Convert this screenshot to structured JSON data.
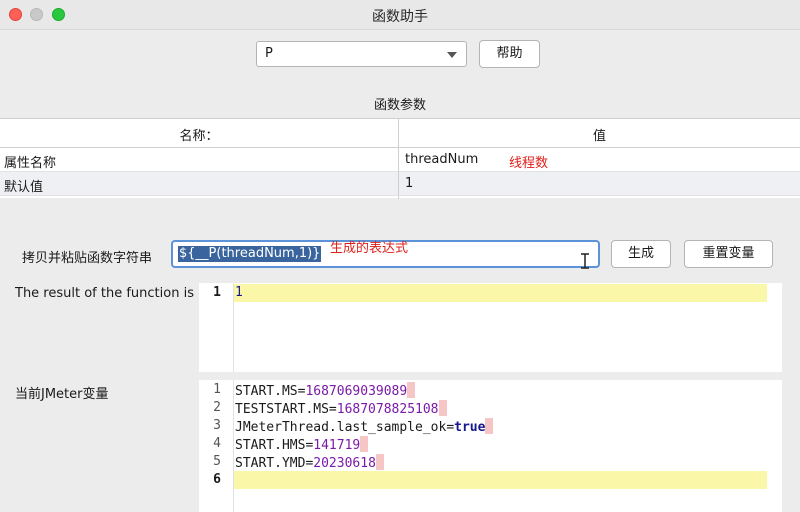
{
  "window": {
    "title": "函数助手"
  },
  "function_select": {
    "value": "P"
  },
  "help_button": {
    "label": "帮助"
  },
  "params_section": {
    "title": "函数参数"
  },
  "params_table": {
    "headers": [
      "名称：",
      "值"
    ],
    "rows": [
      {
        "name": "属性名称",
        "value": "threadNum"
      },
      {
        "name": "默认值",
        "value": "1"
      }
    ]
  },
  "annotations": {
    "thread_num": "线程数",
    "generated_expr": "生成的表达式"
  },
  "copy_paste": {
    "label": "拷贝并粘贴函数字符串",
    "expression": "${__P(threadNum,1)}"
  },
  "generate_button": {
    "label": "生成"
  },
  "reset_button": {
    "label": "重置变量"
  },
  "result": {
    "label": "The result of the function is",
    "line_numbers": [
      "1"
    ],
    "lines": [
      "1"
    ]
  },
  "jmeter_vars": {
    "label": "当前JMeter变量",
    "line_numbers": [
      "1",
      "2",
      "3",
      "4",
      "5",
      "6"
    ],
    "lines": [
      {
        "key": "START.MS",
        "value": "1687069039089"
      },
      {
        "key": "TESTSTART.MS",
        "value": "1687078825108"
      },
      {
        "key": "JMeterThread.last_sample_ok",
        "value": "true"
      },
      {
        "key": "START.HMS",
        "value": "141719"
      },
      {
        "key": "START.YMD",
        "value": "20230618"
      }
    ],
    "equals": "="
  },
  "colors": {
    "accent": "#5b92d8",
    "annotation": "#e0201a",
    "current_line": "#fbf7a8",
    "selection": "#39649e"
  }
}
